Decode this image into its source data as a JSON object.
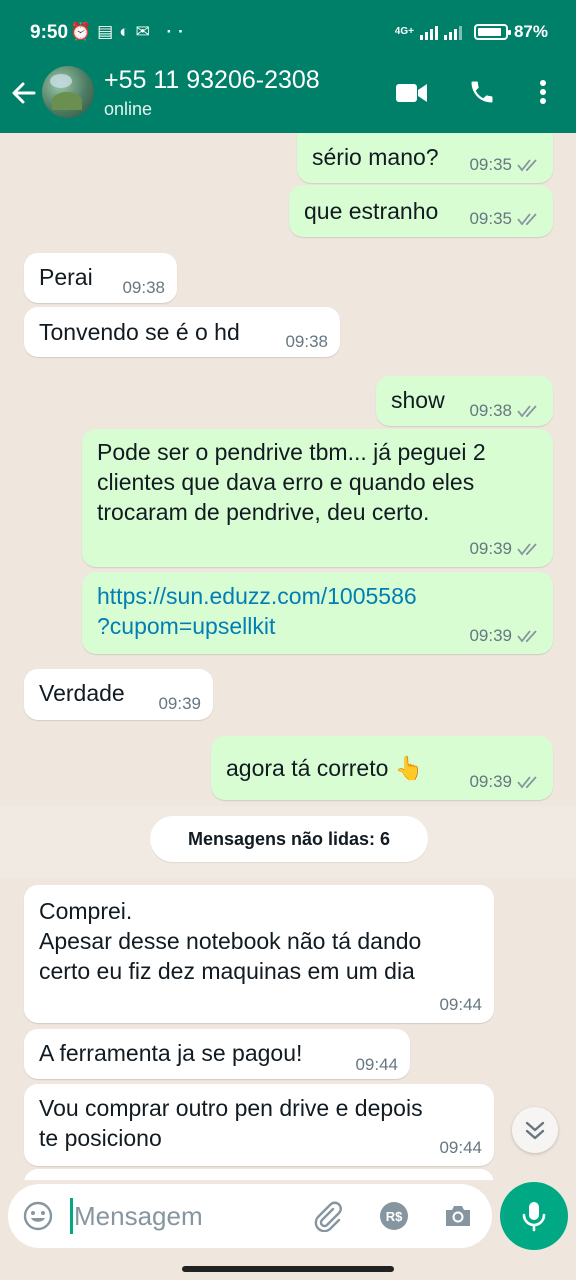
{
  "status_bar": {
    "time": "9:50",
    "network": "4G+",
    "battery": "87%",
    "battery_level": 0.87
  },
  "header": {
    "contact": "+55 11 93206-2308",
    "presence": "online",
    "icons": [
      "back-arrow-icon",
      "video-call-icon",
      "voice-call-icon",
      "more-options-icon"
    ]
  },
  "messages": [
    {
      "dir": "out",
      "lines": [
        "sério mano?"
      ],
      "time": "09:35",
      "read": true
    },
    {
      "dir": "out",
      "lines": [
        "que estranho"
      ],
      "time": "09:35",
      "read": true
    },
    {
      "dir": "in",
      "lines": [
        "Perai"
      ],
      "time": "09:38"
    },
    {
      "dir": "in",
      "lines": [
        "Tonvendo se é o hd"
      ],
      "time": "09:38"
    },
    {
      "dir": "out",
      "lines": [
        "show"
      ],
      "time": "09:38",
      "read": true
    },
    {
      "dir": "out",
      "lines": [
        "Pode ser o pendrive tbm... já peguei 2",
        "clientes que dava erro e quando eles",
        "trocaram de pendrive, deu certo."
      ],
      "time": "09:39",
      "read": true
    },
    {
      "dir": "out",
      "lines": [
        "https://sun.eduzz.com/1005586",
        "?cupom=upsellkit"
      ],
      "time": "09:39",
      "read": true,
      "link": true
    },
    {
      "dir": "in",
      "lines": [
        "Verdade"
      ],
      "time": "09:39"
    },
    {
      "dir": "out",
      "lines": [
        "agora tá correto 👆"
      ],
      "time": "09:39",
      "read": true
    },
    {
      "dir": "in",
      "lines": [
        "Comprei.",
        "Apesar desse notebook não tá dando",
        "certo eu fiz dez maquinas em um dia"
      ],
      "time": "09:44"
    },
    {
      "dir": "in",
      "lines": [
        "A ferramenta ja se pagou!"
      ],
      "time": "09:44"
    },
    {
      "dir": "in",
      "lines": [
        "Vou comprar outro pen drive e depois",
        "te posiciono"
      ],
      "time": "09:44"
    }
  ],
  "unread_label": "Mensagens não lidas: 6",
  "composer": {
    "placeholder": "Mensagem",
    "icons": [
      "emoji-icon",
      "attach-icon",
      "payment-icon",
      "camera-icon",
      "mic-icon"
    ]
  }
}
